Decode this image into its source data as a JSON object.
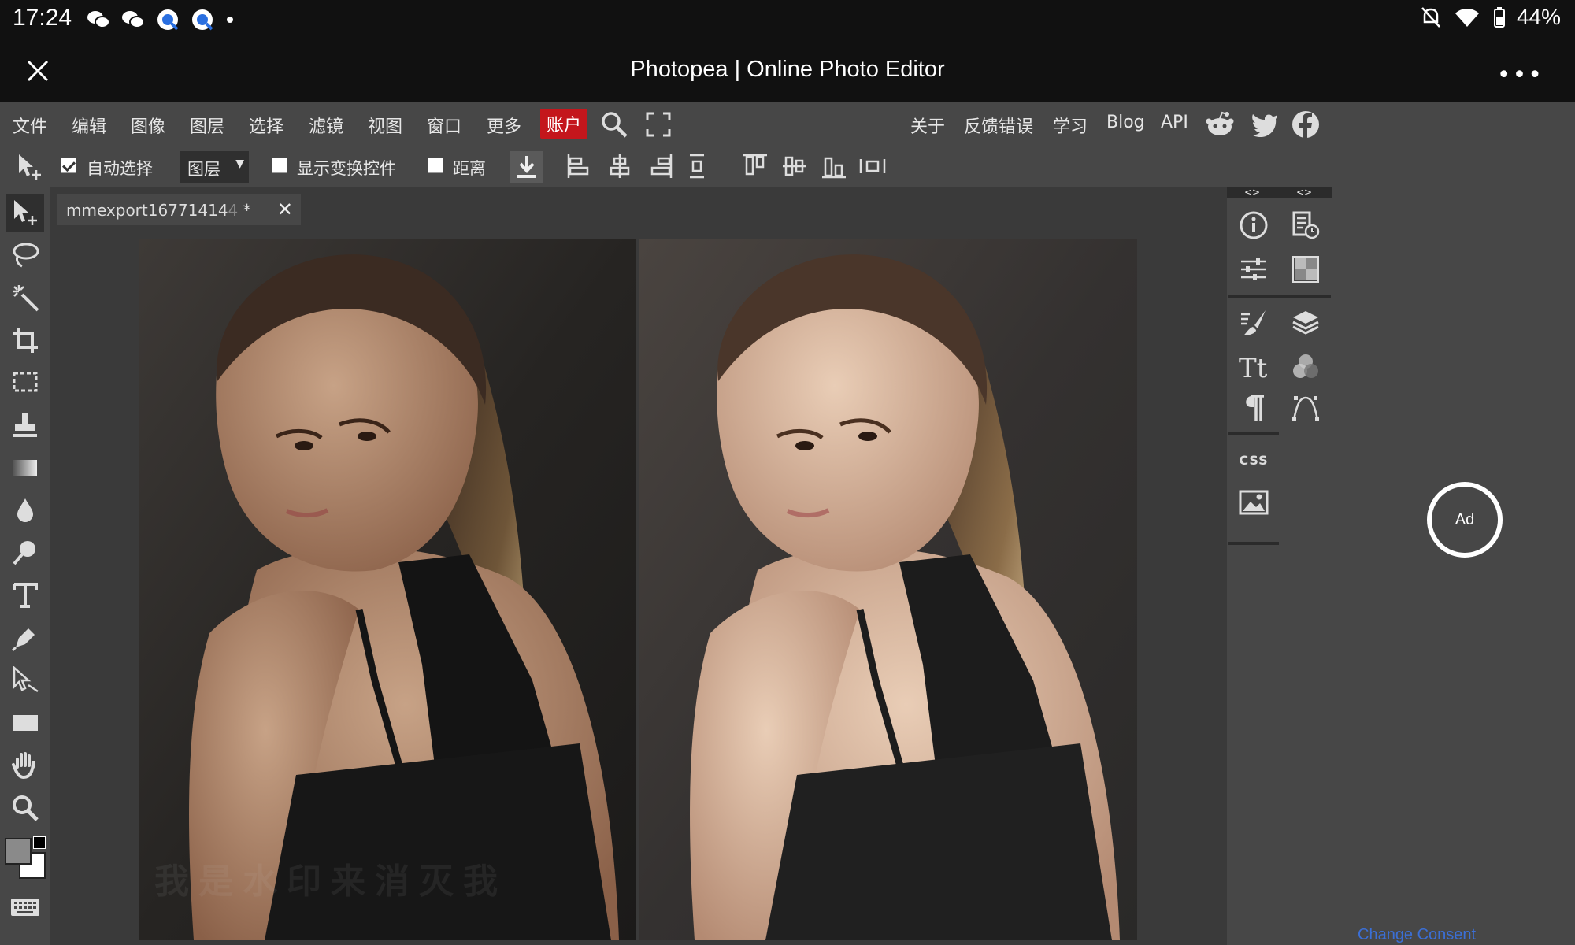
{
  "status_bar": {
    "time": "17:24",
    "battery": "44%"
  },
  "title_bar": {
    "title": "Photopea | Online Photo Editor"
  },
  "menu": {
    "left": [
      "文件",
      "编辑",
      "图像",
      "图层",
      "选择",
      "滤镜",
      "视图",
      "窗口",
      "更多"
    ],
    "account": "账户",
    "right": [
      "关于",
      "反馈错误",
      "学习",
      "Blog",
      "API"
    ]
  },
  "options": {
    "auto_select": {
      "label": "自动选择",
      "checked": true
    },
    "layer_select": "图层",
    "show_transform": {
      "label": "显示变换控件",
      "checked": false
    },
    "distance": {
      "label": "距离",
      "checked": false
    }
  },
  "document": {
    "tab_name": "mmexport16771414",
    "tab_name_faded": "4",
    "modified": " *"
  },
  "watermark": "我是水印来消灭我",
  "ad": {
    "label": "Ad"
  },
  "consent": "Change Consent",
  "right_panel": {
    "css_label": "CSS"
  },
  "colors": {
    "accent_account": "#c4161c",
    "workspace": "#3a3a3a",
    "chrome": "#474747",
    "bar": "#111111"
  }
}
